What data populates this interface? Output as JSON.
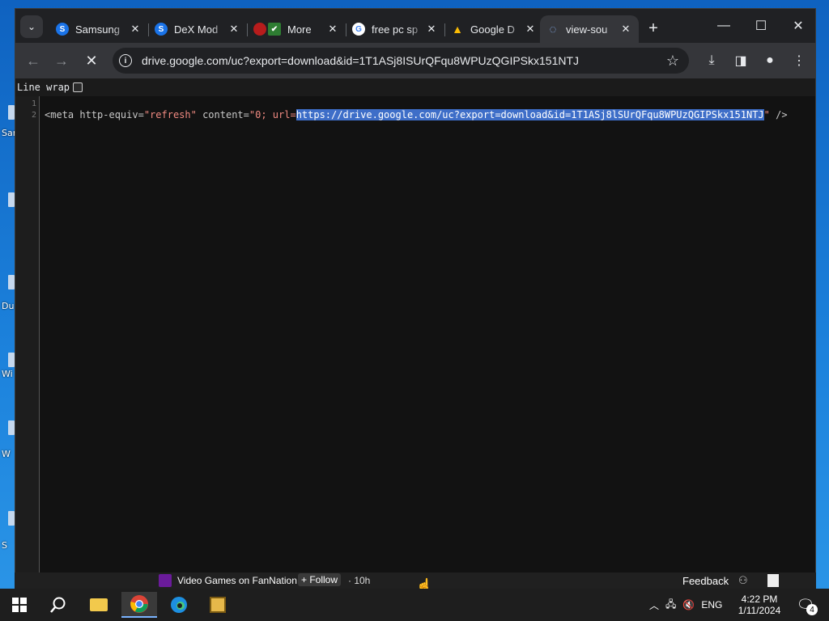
{
  "desktop": {
    "labels": [
      "Sam",
      "Du",
      "Wi",
      "W",
      "S"
    ]
  },
  "browser": {
    "tabs": [
      {
        "label": "Samsung",
        "favicon": "S",
        "color": "#1a73e8"
      },
      {
        "label": "DeX Mod",
        "favicon": "S",
        "color": "#1a73e8"
      },
      {
        "label": "More",
        "favicon": "✔",
        "color": "#2e7d32"
      },
      {
        "label": "free pc sp",
        "favicon": "G",
        "color": "#ffffff"
      },
      {
        "label": "Google D",
        "favicon": "▲",
        "color": "#fbbc04"
      },
      {
        "label": "view-sou",
        "favicon": "◌",
        "color": "#35363a"
      }
    ],
    "url": "drive.google.com/uc?export=download&id=1T1ASj8ISUrQFqu8WPUzQGIPSkx151NTJ",
    "line_wrap_label": "Line wrap"
  },
  "source": {
    "line_numbers": [
      "1",
      "2"
    ],
    "code": {
      "open": "<meta http-equiv=",
      "http_equiv": "\"refresh\"",
      "content_attr": " content=",
      "content_prefix": "\"0; url=",
      "link": "https://drive.google.com/uc?export=download&id=1T1ASj8lSUrQFqu8WPUzQGIPSkx151NTJ",
      "close_quote": "\"",
      "close": " />"
    }
  },
  "news": {
    "source": "Video Games on FanNation",
    "follow": "+ Follow",
    "age": "· 10h",
    "feedback": "Feedback"
  },
  "tray": {
    "lang": "ENG",
    "time": "4:22 PM",
    "date": "1/11/2024",
    "notifications": "4"
  }
}
